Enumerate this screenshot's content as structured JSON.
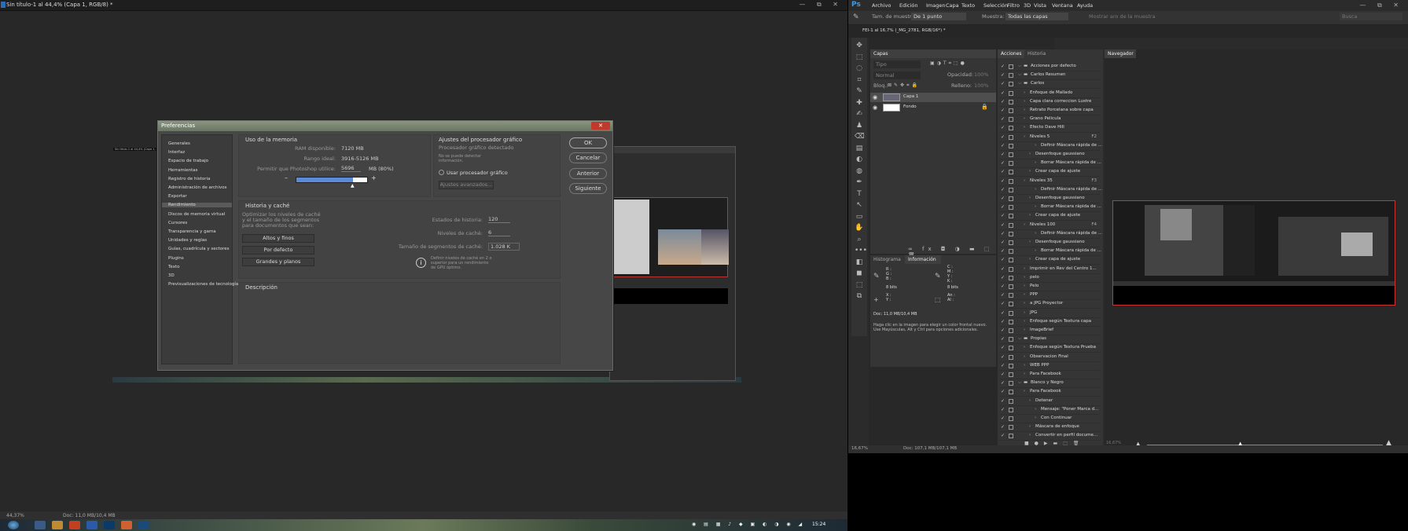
{
  "left_window": {
    "title": "Sin título-1 al 44,4% (Capa 1, RGB/8) *",
    "win_controls": "— ⧉ ✕",
    "status_zoom": "44,37%",
    "status_doc": "Doc: 11,0 MB/10,4 MB",
    "mini_doc_label": "Sin título-1 al 44,4% (Capa 1, RGB/8)",
    "tray_time": "15:24"
  },
  "dialog": {
    "title": "Preferencias",
    "close": "✕",
    "sidebar": [
      "Generales",
      "Interfaz",
      "Espacio de trabajo",
      "Herramientas",
      "Registro de historia",
      "Administración de archivos",
      "Exportar",
      "Rendimiento",
      "Discos de memoria virtual",
      "Cursores",
      "Transparencia y gama",
      "Unidades y reglas",
      "Guías, cuadrícula y sectores",
      "Plugins",
      "Texto",
      "3D",
      "Previsualizaciones de tecnología"
    ],
    "selected_index": 7,
    "memory": {
      "header": "Uso de la memoria",
      "ram_label": "RAM disponible:",
      "ram_value": "7120 MB",
      "ideal_label": "Rango ideal:",
      "ideal_value": "3916-5126 MB",
      "allow_label": "Permitir que Photoshop utilice:",
      "allow_value": "5696",
      "allow_unit": "MB (80%)",
      "minus": "–",
      "plus": "+",
      "slider_fraction": 0.8
    },
    "gpu": {
      "header": "Ajustes del procesador gráfico",
      "detected": "Procesador gráfico detectado",
      "not_detected": "No se puede detectar información.",
      "use_gpu": "Usar procesador gráfico",
      "advanced": "Ajustes avanzados..."
    },
    "history": {
      "header": "Historia y caché",
      "optimize": "Optimizar los niveles de caché y el tamaño de los segmentos para documentos que sean:",
      "btn1": "Altos y finos",
      "btn2": "Por defecto",
      "btn3": "Grandes y planos",
      "states_label": "Estados de historia:",
      "states_value": "120",
      "cache_label": "Niveles de caché:",
      "cache_value": "6",
      "tile_label": "Tamaño de segmentos de caché:",
      "tile_value": "1.028 K",
      "info": "Definir niveles de caché en 2 o superior para un rendimiento de GPU óptimo."
    },
    "description_header": "Descripción",
    "buttons": {
      "ok": "OK",
      "cancel": "Cancelar",
      "prev": "Anterior",
      "next": "Siguiente"
    }
  },
  "right_window": {
    "logo": "Ps",
    "menu": [
      "Archivo",
      "Edición",
      "Imagen",
      "Capa",
      "Texto",
      "Selección",
      "Filtro",
      "3D",
      "Vista",
      "Ventana",
      "Ayuda"
    ],
    "options": {
      "sample_size_label": "Tam. de muestra:",
      "sample_size": "De 1 punto",
      "sample_label": "Muestra:",
      "sample": "Todas las capas",
      "show_ring": "Mostrar aro de la muestra"
    },
    "doc_tab": "FEI-1 al 16,7% (_MG_2781, RGB/16*) *",
    "layers": {
      "tab": "Capas",
      "kind": "Tipo",
      "blend": "Normal",
      "opacity_label": "Opacidad:",
      "opacity": "100%",
      "lock_label": "Bloq.:",
      "fill_label": "Relleno:",
      "fill": "100%",
      "rows": [
        {
          "name": "Capa 1"
        },
        {
          "name": "Fondo"
        }
      ]
    },
    "info": {
      "tabs": [
        "Histograma",
        "Información"
      ],
      "r": "R :",
      "g": "G :",
      "b": "B :",
      "c": "C :",
      "m": "M :",
      "y": "Y :",
      "k": "K :",
      "bits1": "8 bits",
      "bits2": "8 bits",
      "x": "X :",
      "y2": "Y :",
      "an": "An :",
      "al": "Al :",
      "doc": "Doc: 11,0 MB/10,4 MB",
      "hint": "Haga clic en la imagen para elegir un color frontal nuevo. Use Mayúsculas, Alt y Ctrl para opciones adicionales."
    },
    "actions": {
      "tabs": [
        "Acciones",
        "Historia"
      ],
      "rows": [
        {
          "t": "Acciones por defecto",
          "k": "",
          "i": 1,
          "f": true
        },
        {
          "t": "Carlos Resumen",
          "k": "",
          "i": 1,
          "f": true
        },
        {
          "t": "Carlos",
          "k": "",
          "i": 1,
          "f": true
        },
        {
          "t": "Enfoque de Mallado",
          "k": "",
          "i": 2
        },
        {
          "t": "Capa clara correccion Lustre",
          "k": "",
          "i": 2
        },
        {
          "t": "Retrato Porcelana sobre capa",
          "k": "",
          "i": 2
        },
        {
          "t": "Grano Pelicula",
          "k": "",
          "i": 2
        },
        {
          "t": "Efecto Dave Hill",
          "k": "",
          "i": 2
        },
        {
          "t": "Niveles 5",
          "k": "F2",
          "i": 2
        },
        {
          "t": "Definir Máscara rápida de ...",
          "k": "",
          "i": 4
        },
        {
          "t": "Desenfoque gaussiano",
          "k": "",
          "i": 3
        },
        {
          "t": "Borrar Máscara rápida de ...",
          "k": "",
          "i": 4
        },
        {
          "t": "Crear capa de ajuste",
          "k": "",
          "i": 3
        },
        {
          "t": "Niveles 35",
          "k": "F3",
          "i": 2
        },
        {
          "t": "Definir Máscara rápida de ...",
          "k": "",
          "i": 4
        },
        {
          "t": "Desenfoque gaussiano",
          "k": "",
          "i": 3
        },
        {
          "t": "Borrar Máscara rápida de ...",
          "k": "",
          "i": 4
        },
        {
          "t": "Crear capa de ajuste",
          "k": "",
          "i": 3
        },
        {
          "t": "Niveles 100",
          "k": "F4",
          "i": 2
        },
        {
          "t": "Definir Máscara rápida de ...",
          "k": "",
          "i": 4
        },
        {
          "t": "Desenfoque gaussiano",
          "k": "",
          "i": 3
        },
        {
          "t": "Borrar Máscara rápida de ...",
          "k": "",
          "i": 4
        },
        {
          "t": "Crear capa de ajuste",
          "k": "",
          "i": 3
        },
        {
          "t": "Imprimir en Rev del Centro 1...",
          "k": "",
          "i": 2
        },
        {
          "t": "pelo",
          "k": "",
          "i": 2
        },
        {
          "t": "Pelo",
          "k": "",
          "i": 2
        },
        {
          "t": "PPP",
          "k": "",
          "i": 2
        },
        {
          "t": "a JPG Proyector",
          "k": "",
          "i": 2
        },
        {
          "t": "JPG",
          "k": "",
          "i": 2
        },
        {
          "t": "Enfoque según Textura capa",
          "k": "",
          "i": 2
        },
        {
          "t": "ImageBrief",
          "k": "",
          "i": 2
        },
        {
          "t": "Propias",
          "k": "",
          "i": 1,
          "f": true
        },
        {
          "t": "Enfoque según Textura Prueba",
          "k": "",
          "i": 2
        },
        {
          "t": "Observacion Final",
          "k": "",
          "i": 2
        },
        {
          "t": "WEB PPP",
          "k": "",
          "i": 2
        },
        {
          "t": "Para Facebook",
          "k": "",
          "i": 2
        },
        {
          "t": "Blanco y Negro",
          "k": "",
          "i": 1,
          "f": true
        },
        {
          "t": "Para Facebook",
          "k": "",
          "i": 2
        },
        {
          "t": "Detener",
          "k": "",
          "i": 3
        },
        {
          "t": "Mensaje: \"Poner Marca d...",
          "k": "",
          "i": 4
        },
        {
          "t": "Con Continuar",
          "k": "",
          "i": 4
        },
        {
          "t": "Máscara de enfoque",
          "k": "",
          "i": 3
        },
        {
          "t": "Convertir en perfil docume...",
          "k": "",
          "i": 3
        }
      ]
    },
    "navigator_tab": "Navegador",
    "zoom": "16,67%",
    "doc_status": "Doc: 107,1 MB/107,1 MB",
    "nav_zoom": "16,67%",
    "busca": "Busca"
  }
}
